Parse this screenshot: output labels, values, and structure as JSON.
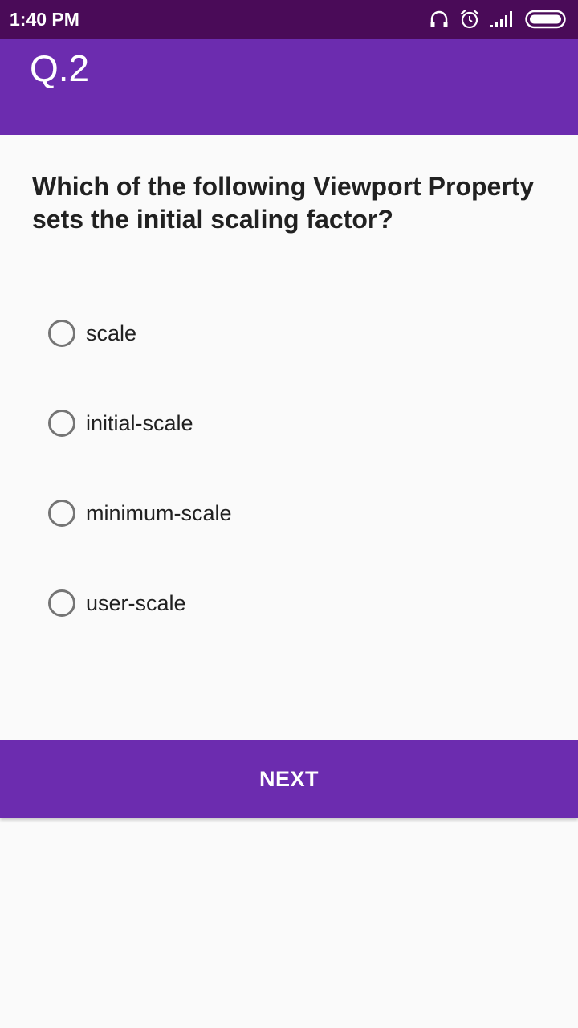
{
  "status_bar": {
    "time": "1:40 PM",
    "icons": [
      "headset-icon",
      "alarm-icon",
      "signal-icon",
      "battery-icon"
    ]
  },
  "app_bar": {
    "title": "Q.2"
  },
  "question": {
    "text": "Which of the following Viewport Property sets the initial scaling factor?"
  },
  "options": [
    {
      "label": "scale",
      "selected": false
    },
    {
      "label": "initial-scale",
      "selected": false
    },
    {
      "label": "minimum-scale",
      "selected": false
    },
    {
      "label": "user-scale",
      "selected": false
    }
  ],
  "actions": {
    "next_label": "NEXT"
  },
  "colors": {
    "status_bar": "#4a0b58",
    "primary": "#6c2caf",
    "background": "#fafafa",
    "radio_outline": "#757575"
  }
}
